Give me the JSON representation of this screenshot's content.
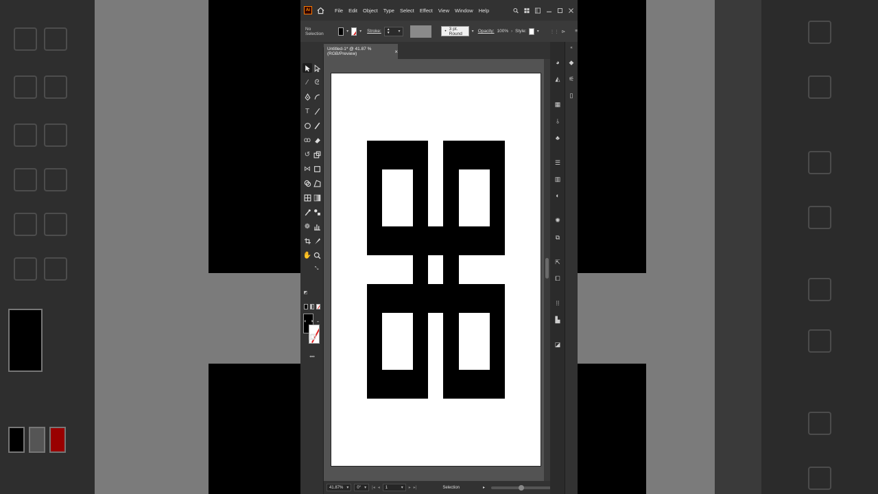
{
  "app": {
    "logo_text": "Ai",
    "menus": [
      "File",
      "Edit",
      "Object",
      "Type",
      "Select",
      "Effect",
      "View",
      "Window",
      "Help"
    ]
  },
  "control_bar": {
    "selection_status": "No Selection",
    "stroke_label": "Stroke:",
    "stroke_profile": "3 pt. Round",
    "opacity_label": "Opacity:",
    "opacity_value": "100%",
    "style_label": "Style:"
  },
  "document": {
    "tab_title": "Untitled-1* @ 41.87 % (RGB/Preview)",
    "close_symbol": "×"
  },
  "status_bar": {
    "zoom": "41.87%",
    "rotation": "0°",
    "artboard_number": "1",
    "tool_name": "Selection"
  },
  "tools": {
    "more_symbol": "•••"
  },
  "colors": {
    "fill": "#000000",
    "stroke": "none",
    "ui_dark": "#323232",
    "canvas_bg": "#535353",
    "accent_orange": "#ff7c00"
  },
  "icons": [
    "selection-tool-icon",
    "direct-selection-tool-icon",
    "magic-wand-icon",
    "lasso-icon",
    "pen-tool-icon",
    "curvature-tool-icon",
    "type-tool-icon",
    "line-segment-icon",
    "ellipse-tool-icon",
    "paintbrush-icon",
    "shaper-tool-icon",
    "eraser-icon",
    "rotate-tool-icon",
    "scale-tool-icon",
    "width-tool-icon",
    "free-transform-icon",
    "shape-builder-icon",
    "perspective-grid-icon",
    "mesh-icon",
    "gradient-icon",
    "eyedropper-icon",
    "blend-icon",
    "symbol-sprayer-icon",
    "graph-icon",
    "artboard-tool-icon",
    "slice-icon",
    "hand-tool-icon",
    "zoom-tool-icon"
  ]
}
